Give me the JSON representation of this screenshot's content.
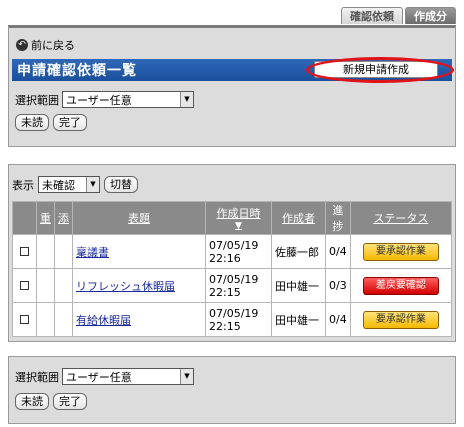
{
  "tabs": [
    {
      "label": "確認依頼",
      "active": false
    },
    {
      "label": "作成分",
      "active": true
    }
  ],
  "back_label": "前に戻る",
  "title": "申請確認依頼一覧",
  "new_request_label": "新規申請作成",
  "range_label": "選択範囲",
  "range_value": "ユーザー任意",
  "unread_label": "未読",
  "done_label": "完了",
  "display_label": "表示",
  "display_value": "未確認",
  "switch_label": "切替",
  "columns": {
    "dup": "重",
    "attach": "添",
    "subject": "表題",
    "created": "作成日時",
    "author": "作成者",
    "progress": "進捗",
    "status": "ステータス"
  },
  "rows": [
    {
      "subject": "稟議書",
      "date": "07/05/19",
      "time": "22:16",
      "author": "佐藤一郎",
      "progress": "0/4",
      "status": "要承認作業",
      "status_color": "#f5b800"
    },
    {
      "subject": "リフレッシュ休暇届",
      "date": "07/05/19",
      "time": "22:15",
      "author": "田中雄一",
      "progress": "0/3",
      "status": "差戻要確認",
      "status_color": "#d10000"
    },
    {
      "subject": "有給休暇届",
      "date": "07/05/19",
      "time": "22:15",
      "author": "田中雄一",
      "progress": "0/4",
      "status": "要承認作業",
      "status_color": "#f5b800"
    }
  ],
  "colors": {
    "title_bar": "#1a4f9c",
    "highlight_oval": "#e0121a"
  }
}
